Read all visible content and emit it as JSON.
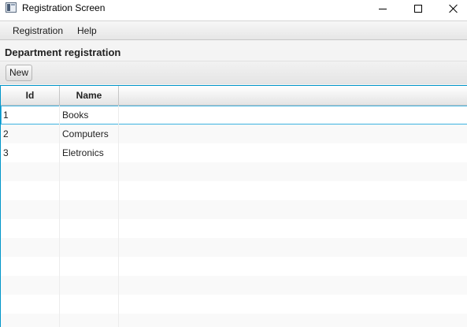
{
  "window": {
    "title": "Registration Screen",
    "icon": "app-window-icon",
    "controls": [
      "minimize-icon",
      "maximize-icon",
      "close-icon"
    ]
  },
  "menu": {
    "items": [
      {
        "label": "Registration"
      },
      {
        "label": "Help"
      }
    ]
  },
  "page": {
    "title": "Department registration"
  },
  "toolbar": {
    "new_label": "New"
  },
  "table": {
    "columns": [
      "Id",
      "Name"
    ],
    "rows": [
      {
        "id": "1",
        "name": "Books"
      },
      {
        "id": "2",
        "name": "Computers"
      },
      {
        "id": "3",
        "name": "Eletronics"
      }
    ],
    "selected_row": 0,
    "empty_rows": 9
  },
  "colors": {
    "focus_border": "#0096c9",
    "selection_border": "#3db2e0",
    "header_bg": "#e4e4e4"
  }
}
